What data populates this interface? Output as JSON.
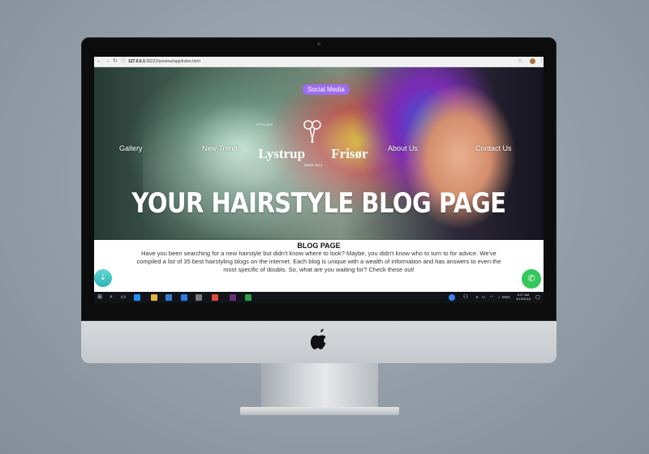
{
  "browser": {
    "url_host": "127.0.0.1",
    "url_path": ":56222/preview/app/index.html"
  },
  "hero": {
    "social_button": "Social Media",
    "nav": [
      "Gallery",
      "New Trends",
      "About Us",
      "Contact Us"
    ],
    "logo": {
      "left_small": "STYLING",
      "name": "Lystrup Frisør",
      "since": "SINCE 2010"
    },
    "headline": "YOUR HAIRSTYLE BLOG PAGE"
  },
  "content": {
    "title": "BLOG PAGE",
    "body": "Have you been searching for a new hairstyle but didn't know where to look? Maybe, you didn't know who to turn to for advice. We've compiled a list of 35 best hairstyling blogs on the internet. Each blog is unique with a wealth of information and has answers to even the most specific of doubts. So, what are you waiting for? Check these out!"
  },
  "taskbar": {
    "language": "ENG",
    "time": "8:27 AM",
    "date": "4/19/2018"
  },
  "colors": {
    "social_button": "#9d6df0",
    "whatsapp_fab": "#34c759",
    "teal_fab": "#2ab4b8"
  }
}
